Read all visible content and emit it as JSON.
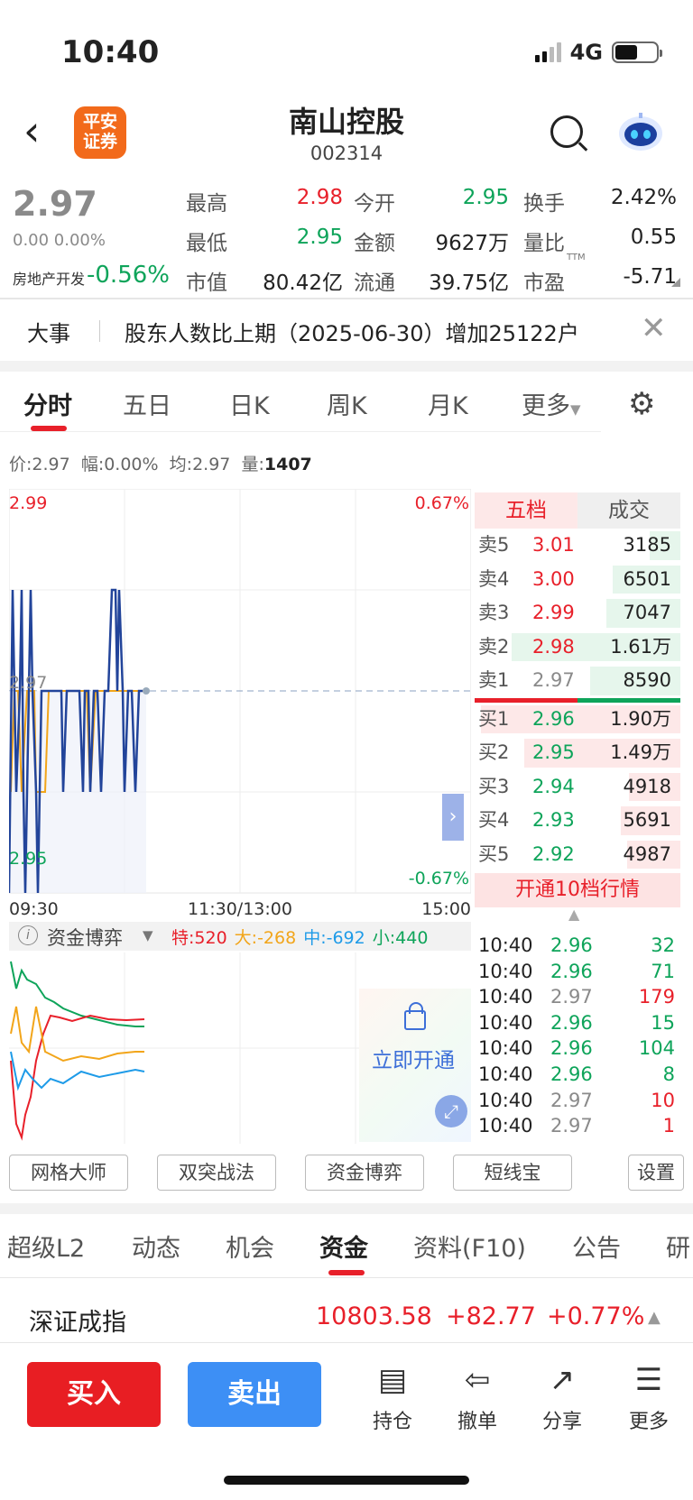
{
  "status_bar": {
    "time": "10:40",
    "network": "4G"
  },
  "header": {
    "logo_text": "平安证券",
    "stock_name": "南山控股",
    "stock_code": "002314"
  },
  "quote": {
    "price": "2.97",
    "change": "0.00 0.00%",
    "sector_name": "房地产开发",
    "sector_change": "-0.56%",
    "fields": [
      {
        "label": "最高",
        "value": "2.98"
      },
      {
        "label": "今开",
        "value": "2.95"
      },
      {
        "label": "换手",
        "value": "2.42%"
      },
      {
        "label": "最低",
        "value": "2.95"
      },
      {
        "label": "金额",
        "value": "9627万"
      },
      {
        "label": "量比",
        "value": "0.55"
      },
      {
        "label": "市值",
        "value": "80.42亿"
      },
      {
        "label": "流通",
        "value": "39.75亿"
      },
      {
        "label": "市盈",
        "value": "-5.71",
        "sup": "TTM"
      }
    ]
  },
  "news": {
    "tag": "大事",
    "text": "股东人数比上期（2025-06-30）增加25122户"
  },
  "chart_tabs": [
    "分时",
    "五日",
    "日K",
    "周K",
    "月K",
    "更多"
  ],
  "info_line": {
    "price_label": "价:",
    "price": "2.97",
    "amp_label": "幅:",
    "amp": "0.00%",
    "avg_label": "均:",
    "avg": "2.97",
    "vol_label": "量:",
    "vol": "1407"
  },
  "chart_data": {
    "type": "line",
    "y_top": "2.99",
    "y_mid": "2.97",
    "y_bottom": "2.95",
    "pct_top": "0.67%",
    "pct_bottom": "-0.67%",
    "x_labels": [
      "09:30",
      "11:30/13:00",
      "15:00"
    ],
    "ylim": [
      2.95,
      2.99
    ],
    "series": []
  },
  "order_book": {
    "tabs": [
      "五档",
      "成交"
    ],
    "sells": [
      {
        "label": "卖5",
        "price": "3.01",
        "vol": "3185",
        "color": "red",
        "bar": 0.15
      },
      {
        "label": "卖4",
        "price": "3.00",
        "vol": "6501",
        "color": "red",
        "bar": 0.33
      },
      {
        "label": "卖3",
        "price": "2.99",
        "vol": "7047",
        "color": "red",
        "bar": 0.36
      },
      {
        "label": "卖2",
        "price": "2.98",
        "vol": "1.61万",
        "color": "red",
        "bar": 0.82
      },
      {
        "label": "卖1",
        "price": "2.97",
        "vol": "8590",
        "color": "gray",
        "bar": 0.44
      }
    ],
    "buys": [
      {
        "label": "买1",
        "price": "2.96",
        "vol": "1.90万",
        "color": "green",
        "bar": 0.97
      },
      {
        "label": "买2",
        "price": "2.95",
        "vol": "1.49万",
        "color": "green",
        "bar": 0.76
      },
      {
        "label": "买3",
        "price": "2.94",
        "vol": "4918",
        "color": "green",
        "bar": 0.25
      },
      {
        "label": "买4",
        "price": "2.93",
        "vol": "5691",
        "color": "green",
        "bar": 0.29
      },
      {
        "label": "买5",
        "price": "2.92",
        "vol": "4987",
        "color": "green",
        "bar": 0.26
      }
    ],
    "open_more": "开通10档行情"
  },
  "trades": [
    {
      "time": "10:40",
      "price": "2.96",
      "vol": "32",
      "pc": "green",
      "vc": "green"
    },
    {
      "time": "10:40",
      "price": "2.96",
      "vol": "71",
      "pc": "green",
      "vc": "green"
    },
    {
      "time": "10:40",
      "price": "2.97",
      "vol": "179",
      "pc": "gray",
      "vc": "red"
    },
    {
      "time": "10:40",
      "price": "2.96",
      "vol": "15",
      "pc": "green",
      "vc": "green"
    },
    {
      "time": "10:40",
      "price": "2.96",
      "vol": "104",
      "pc": "green",
      "vc": "green"
    },
    {
      "time": "10:40",
      "price": "2.96",
      "vol": "8",
      "pc": "green",
      "vc": "green"
    },
    {
      "time": "10:40",
      "price": "2.97",
      "vol": "10",
      "pc": "gray",
      "vc": "red"
    },
    {
      "time": "10:40",
      "price": "2.97",
      "vol": "1",
      "pc": "gray",
      "vc": "red"
    }
  ],
  "funds": {
    "title": "资金博弈",
    "legend": [
      {
        "text": "特:520",
        "color": "#e8202a"
      },
      {
        "text": "大:-268",
        "color": "#f2a51a"
      },
      {
        "text": "中:-692",
        "color": "#1e9be8"
      },
      {
        "text": "小:440",
        "color": "#0ea45a"
      }
    ],
    "unlock": "立即开通"
  },
  "tools": [
    "网格大师",
    "双突战法",
    "资金博弈",
    "短线宝",
    "设置"
  ],
  "bottom_tabs": [
    "超级L2",
    "动态",
    "机会",
    "资金",
    "资料(F10)",
    "公告",
    "研"
  ],
  "index_bar": {
    "name": "深证成指",
    "value": "10803.58",
    "change": "+82.77",
    "pct": "+0.77%"
  },
  "actions": {
    "buy": "买入",
    "sell": "卖出",
    "items": [
      "持仓",
      "撤单",
      "分享",
      "更多"
    ]
  },
  "colors": {
    "red": "#e8202a",
    "green": "#0ea45a",
    "blue": "#3d8ff5",
    "brand": "#f26a1b"
  }
}
